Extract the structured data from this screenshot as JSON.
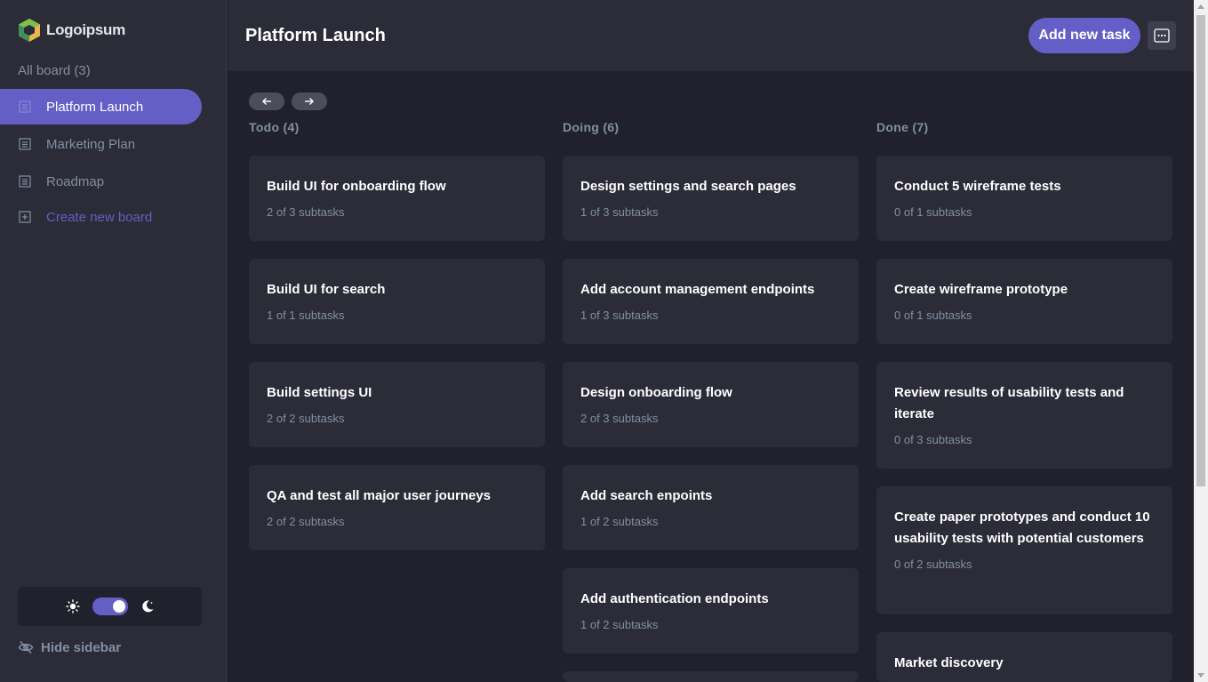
{
  "app": {
    "logo_text": "Logoipsum"
  },
  "sidebar": {
    "all_boards_label": "All board (3)",
    "boards": [
      {
        "label": "Platform Launch",
        "active": true
      },
      {
        "label": "Marketing Plan",
        "active": false
      },
      {
        "label": "Roadmap",
        "active": false
      }
    ],
    "create_label": "Create new board",
    "hide_label": "Hide sidebar",
    "theme": {
      "dark_mode_on": true
    }
  },
  "header": {
    "title": "Platform Launch",
    "add_task_label": "Add new task",
    "more_icon": "more-options-icon"
  },
  "colors": {
    "accent": "#635fc7",
    "background": "#20212c",
    "surface": "#2b2c37",
    "muted_text": "#828fa3"
  },
  "columns": [
    {
      "title": "Todo (4)",
      "tasks": [
        {
          "title": "Build UI for onboarding flow",
          "subtasks": "2 of 3 subtasks"
        },
        {
          "title": "Build UI for search",
          "subtasks": "1 of 1 subtasks"
        },
        {
          "title": "Build settings UI",
          "subtasks": "2 of 2 subtasks"
        },
        {
          "title": "QA and test all major user journeys",
          "subtasks": "2 of 2 subtasks"
        }
      ]
    },
    {
      "title": "Doing (6)",
      "tasks": [
        {
          "title": "Design settings and search pages",
          "subtasks": "1 of 3 subtasks"
        },
        {
          "title": "Add account management endpoints",
          "subtasks": "1 of 3 subtasks"
        },
        {
          "title": "Design onboarding flow",
          "subtasks": "2 of 3 subtasks"
        },
        {
          "title": "Add search enpoints",
          "subtasks": "1 of 2 subtasks"
        },
        {
          "title": "Add authentication endpoints",
          "subtasks": "1 of 2 subtasks"
        }
      ]
    },
    {
      "title": "Done (7)",
      "tasks": [
        {
          "title": "Conduct 5 wireframe tests",
          "subtasks": "0 of 1 subtasks"
        },
        {
          "title": "Create wireframe prototype",
          "subtasks": "0 of 1 subtasks"
        },
        {
          "title": "Review results of usability tests and iterate",
          "subtasks": "0 of 3 subtasks"
        },
        {
          "title": "Create paper prototypes and conduct 10 usability tests with potential customers",
          "subtasks": "0 of 2 subtasks"
        },
        {
          "title": "Market discovery",
          "subtasks": ""
        }
      ]
    }
  ]
}
